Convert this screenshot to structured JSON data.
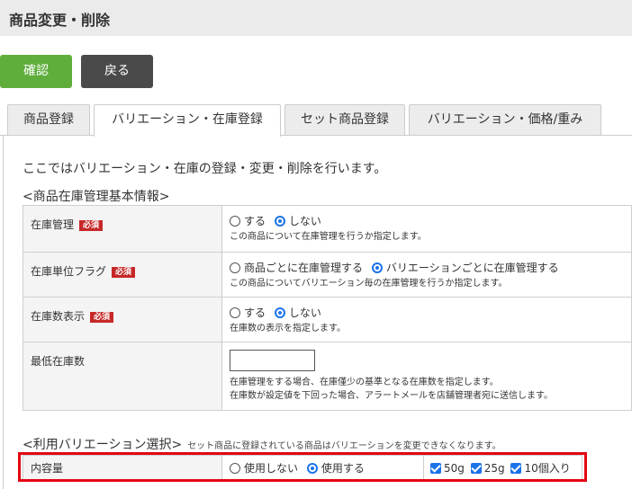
{
  "header": {
    "title": "商品変更・削除"
  },
  "buttons": {
    "confirm": "確認",
    "back": "戻る"
  },
  "tabs": [
    {
      "label": "商品登録"
    },
    {
      "label": "バリエーション・在庫登録"
    },
    {
      "label": "セット商品登録"
    },
    {
      "label": "バリエーション・価格/重み"
    }
  ],
  "intro": "ここではバリエーション・在庫の登録・変更・削除を行います。",
  "basic_section": {
    "title": "<商品在庫管理基本情報>",
    "required_badge": "必須",
    "rows": [
      {
        "label": "在庫管理",
        "options": [
          "する",
          "しない"
        ],
        "help": "この商品について在庫管理を行うか指定します。"
      },
      {
        "label": "在庫単位フラグ",
        "options": [
          "商品ごとに在庫管理する",
          "バリエーションごとに在庫管理する"
        ],
        "help": "この商品についてバリエーション毎の在庫管理を行うか指定します。"
      },
      {
        "label": "在庫数表示",
        "options": [
          "する",
          "しない"
        ],
        "help": "在庫数の表示を指定します。"
      },
      {
        "label": "最低在庫数",
        "help1": "在庫管理をする場合、在庫僅少の基準となる在庫数を指定します。",
        "help2": "在庫数が設定値を下回った場合、アラートメールを店舗管理者宛に送信します。"
      }
    ]
  },
  "variation_section": {
    "title": "<利用バリエーション選択>",
    "note": "セット商品に登録されている商品はバリエーションを変更できなくなります。",
    "row": {
      "label": "内容量",
      "options": [
        "使用しない",
        "使用する"
      ],
      "values": [
        "50g",
        "25g",
        "10個入り"
      ]
    }
  }
}
